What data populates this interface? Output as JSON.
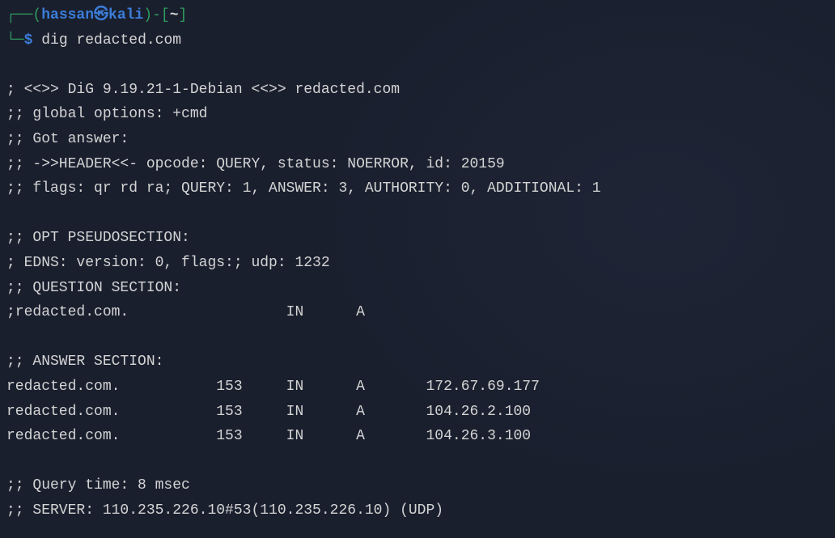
{
  "prompt": {
    "user": "hassan",
    "at_symbol": "㉿",
    "host": "kali",
    "path": "~",
    "dollar": "$",
    "command": "dig",
    "args": "redacted.com"
  },
  "output": {
    "version_line": "; <<>> DiG 9.19.21-1-Debian <<>> redacted.com",
    "global_options": ";; global options: +cmd",
    "got_answer": ";; Got answer:",
    "header_line": ";; ->>HEADER<<- opcode: QUERY, status: NOERROR, id: 20159",
    "flags_line": ";; flags: qr rd ra; QUERY: 1, ANSWER: 3, AUTHORITY: 0, ADDITIONAL: 1",
    "opt_header": ";; OPT PSEUDOSECTION:",
    "edns_line": "; EDNS: version: 0, flags:; udp: 1232",
    "question_header": ";; QUESTION SECTION:",
    "question_line": ";redacted.com.                  IN      A",
    "answer_header": ";; ANSWER SECTION:",
    "answer_1": "redacted.com.           153     IN      A       172.67.69.177",
    "answer_2": "redacted.com.           153     IN      A       104.26.2.100",
    "answer_3": "redacted.com.           153     IN      A       104.26.3.100",
    "query_time": ";; Query time: 8 msec",
    "server_line": ";; SERVER: 110.235.226.10#53(110.235.226.10) (UDP)"
  }
}
